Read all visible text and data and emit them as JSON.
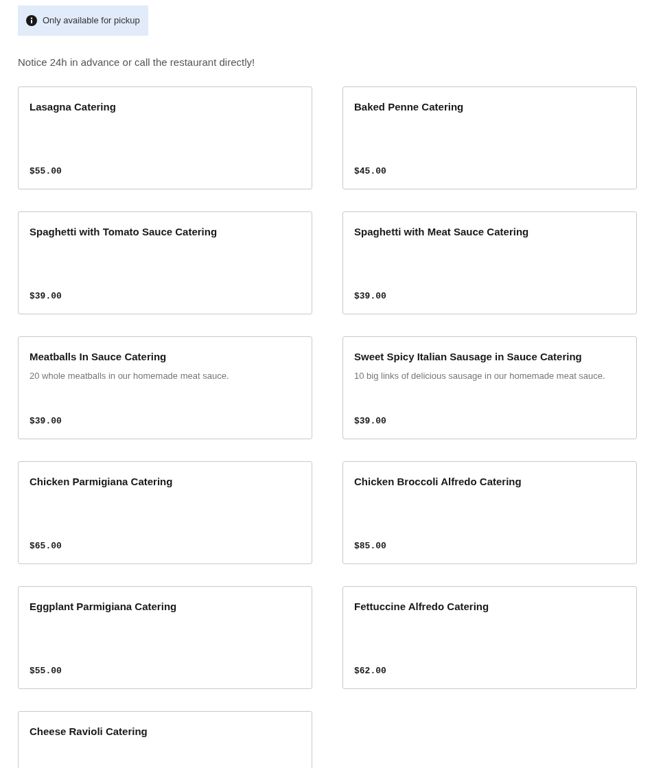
{
  "notice_banner": {
    "text": "Only available for pickup"
  },
  "note": "Notice 24h in advance or call the restaurant directly!",
  "items": [
    {
      "name": "Lasagna Catering",
      "price": "$55.00"
    },
    {
      "name": "Baked Penne Catering",
      "price": "$45.00"
    },
    {
      "name": "Spaghetti with Tomato Sauce Catering",
      "price": "$39.00"
    },
    {
      "name": "Spaghetti with Meat Sauce Catering",
      "price": "$39.00"
    },
    {
      "name": "Meatballs In Sauce Catering",
      "description": "20 whole meatballs in our homemade meat sauce.",
      "price": "$39.00"
    },
    {
      "name": "Sweet Spicy Italian Sausage in Sauce Catering",
      "description": "10 big links of delicious sausage in our homemade meat sauce.",
      "price": "$39.00"
    },
    {
      "name": "Chicken Parmigiana Catering",
      "price": "$65.00"
    },
    {
      "name": "Chicken Broccoli Alfredo Catering",
      "price": "$85.00"
    },
    {
      "name": "Eggplant Parmigiana Catering",
      "price": "$55.00"
    },
    {
      "name": "Fettuccine Alfredo Catering",
      "price": "$62.00"
    },
    {
      "name": "Cheese Ravioli Catering"
    }
  ]
}
